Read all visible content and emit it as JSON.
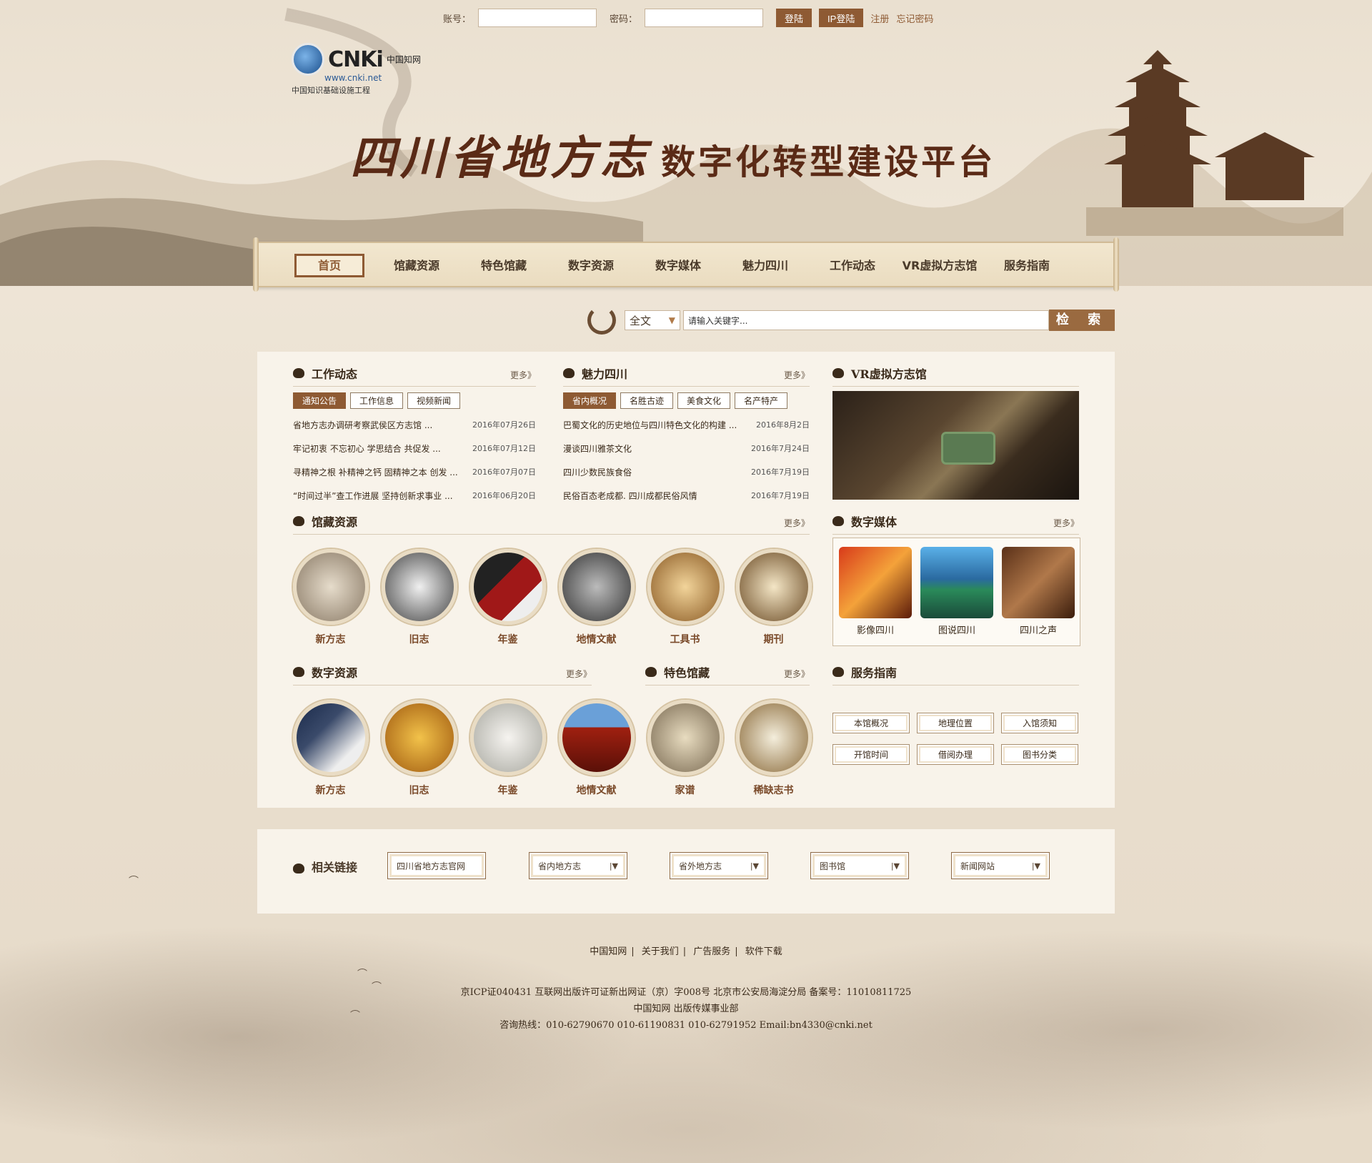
{
  "topbar": {
    "account_label": "账号：",
    "password_label": "密码：",
    "login_button": "登陆",
    "ip_login_button": "IP登陆",
    "register_link": "注册",
    "forgot_link": "忘记密码"
  },
  "logo": {
    "brand": "CNKi",
    "brand_cn": "中国知网",
    "url": "www.cnki.net",
    "subtitle": "中国知识基础设施工程"
  },
  "banner": {
    "title_main": "四川省地方志",
    "title_sub": "数字化转型建设平台"
  },
  "nav": {
    "items": [
      {
        "label": "首页",
        "active": true
      },
      {
        "label": "馆藏资源",
        "active": false
      },
      {
        "label": "特色馆藏",
        "active": false
      },
      {
        "label": "数字资源",
        "active": false
      },
      {
        "label": "数字媒体",
        "active": false
      },
      {
        "label": "魅力四川",
        "active": false
      },
      {
        "label": "工作动态",
        "active": false
      },
      {
        "label": "VR虚拟方志馆",
        "active": false
      },
      {
        "label": "服务指南",
        "active": false
      }
    ]
  },
  "search": {
    "scope": "全文",
    "placeholder": "请输入关键字...",
    "button": "检 索"
  },
  "work_news": {
    "title": "工作动态",
    "more": "更多》",
    "tabs": [
      "通知公告",
      "工作信息",
      "视频新闻"
    ],
    "items": [
      {
        "text": "省地方志办调研考察武侯区方志馆 ...",
        "date": "2016年07月26日"
      },
      {
        "text": "牢记初衷  不忘初心  学思结合  共促发 ...",
        "date": "2016年07月12日"
      },
      {
        "text": "寻精神之根  补精神之钙  固精神之本  创发 ...",
        "date": "2016年07月07日"
      },
      {
        "text": "“时间过半”查工作进展  坚持创新求事业 ...",
        "date": "2016年06月20日"
      }
    ]
  },
  "charm": {
    "title": "魅力四川",
    "more": "更多》",
    "tabs": [
      "省内概况",
      "名胜古迹",
      "美食文化",
      "名产特产"
    ],
    "items": [
      {
        "text": "巴蜀文化的历史地位与四川特色文化的构建 ...",
        "date": "2016年8月2日"
      },
      {
        "text": "漫谈四川雅茶文化",
        "date": "2016年7月24日"
      },
      {
        "text": "四川少数民族食俗",
        "date": "2016年7月19日"
      },
      {
        "text": "民俗百态老成都. 四川成都民俗风情",
        "date": "2016年7月19日"
      }
    ]
  },
  "vr": {
    "title": "VR虚拟方志馆"
  },
  "collection": {
    "title": "馆藏资源",
    "more": "更多》",
    "items": [
      "新方志",
      "旧志",
      "年鉴",
      "地情文献",
      "工具书",
      "期刊"
    ]
  },
  "media": {
    "title": "数字媒体",
    "more": "更多》",
    "items": [
      "影像四川",
      "图说四川",
      "四川之声"
    ]
  },
  "digital": {
    "title": "数字资源",
    "more": "更多》",
    "items": [
      "新方志",
      "旧志",
      "年鉴",
      "地情文献"
    ]
  },
  "special": {
    "title": "特色馆藏",
    "more": "更多》",
    "items": [
      "家谱",
      "稀缺志书"
    ]
  },
  "service": {
    "title": "服务指南",
    "items": [
      "本馆概况",
      "地理位置",
      "入馆须知",
      "开馆时间",
      "借阅办理",
      "图书分类"
    ]
  },
  "links": {
    "title": "相关链接",
    "items": [
      "四川省地方志官网",
      "省内地方志",
      "省外地方志",
      "图书馆",
      "新闻网站"
    ]
  },
  "footer": {
    "links": [
      "中国知网",
      "关于我们",
      "广告服务",
      "软件下载"
    ],
    "icp": "京ICP证040431  互联网出版许可证新出网证（京）字008号  北京市公安局海淀分局  备案号：11010811725",
    "org": "中国知网  出版传媒事业部",
    "contact": "咨询热线：010-62790670    010-61190831    010-62791952    Email:bn4330@cnki.net"
  },
  "colors": {
    "accent_brown": "#8e5a33",
    "title_brown": "#5a2a16",
    "panel_bg": "#f8f3ea"
  }
}
